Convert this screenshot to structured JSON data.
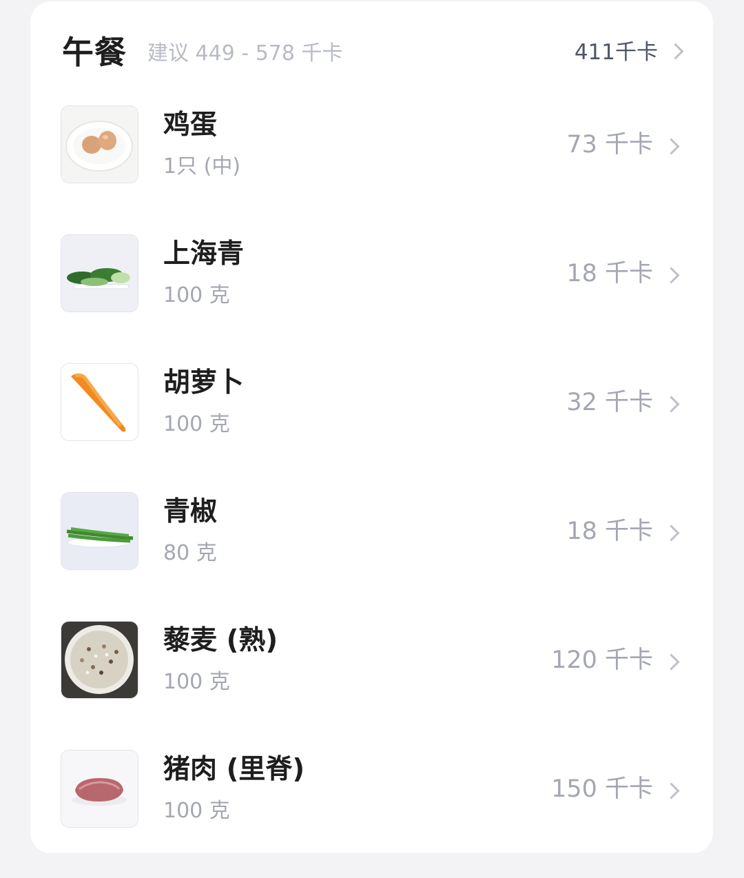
{
  "meal": {
    "title": "午餐",
    "suggestion": "建议 449 - 578 千卡",
    "total": "411千卡"
  },
  "items": [
    {
      "name": "鸡蛋",
      "qty": "1只 (中)",
      "kcal": "73 千卡",
      "icon": "egg-image"
    },
    {
      "name": "上海青",
      "qty": "100 克",
      "kcal": "18 千卡",
      "icon": "bok-choy-image"
    },
    {
      "name": "胡萝卜",
      "qty": "100 克",
      "kcal": "32 千卡",
      "icon": "carrot-image"
    },
    {
      "name": "青椒",
      "qty": "80 克",
      "kcal": "18 千卡",
      "icon": "green-pepper-image"
    },
    {
      "name": "藜麦 (熟)",
      "qty": "100 克",
      "kcal": "120 千卡",
      "icon": "quinoa-image"
    },
    {
      "name": "猪肉 (里脊)",
      "qty": "100 克",
      "kcal": "150 千卡",
      "icon": "pork-loin-image"
    }
  ]
}
